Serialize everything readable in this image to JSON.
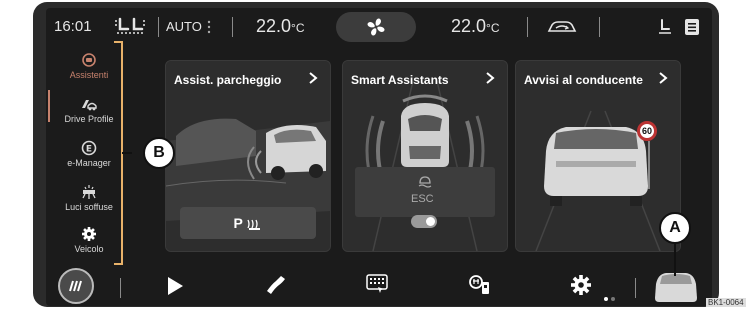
{
  "topbar": {
    "time": "16:01",
    "auto_label": "AUTO",
    "temp_left": "22.0",
    "temp_left_unit": "°C",
    "temp_right": "22.0",
    "temp_right_unit": "°C"
  },
  "sidebar": {
    "items": [
      {
        "label": "Assistenti",
        "icon": "driver-assist-icon",
        "active": true
      },
      {
        "label": "Drive Profile",
        "icon": "drive-profile-icon",
        "active": false
      },
      {
        "label": "e-Manager",
        "icon": "e-manager-icon",
        "active": false
      },
      {
        "label": "Luci soffuse",
        "icon": "ambient-light-icon",
        "active": false
      },
      {
        "label": "Veicolo",
        "icon": "gear-icon",
        "active": false
      }
    ]
  },
  "cards": [
    {
      "title": "Assist. parcheggio",
      "button_label": "P"
    },
    {
      "title": "Smart Assistants",
      "esc_label": "ESC"
    },
    {
      "title": "Avvisi al conducente",
      "speed_sign": "60"
    }
  ],
  "callouts": {
    "a": "A",
    "b": "B"
  },
  "image_code": "BK1-0064",
  "colors": {
    "accent": "#c7826d",
    "background": "#1b1b1b",
    "card": "#2d2d2d"
  }
}
